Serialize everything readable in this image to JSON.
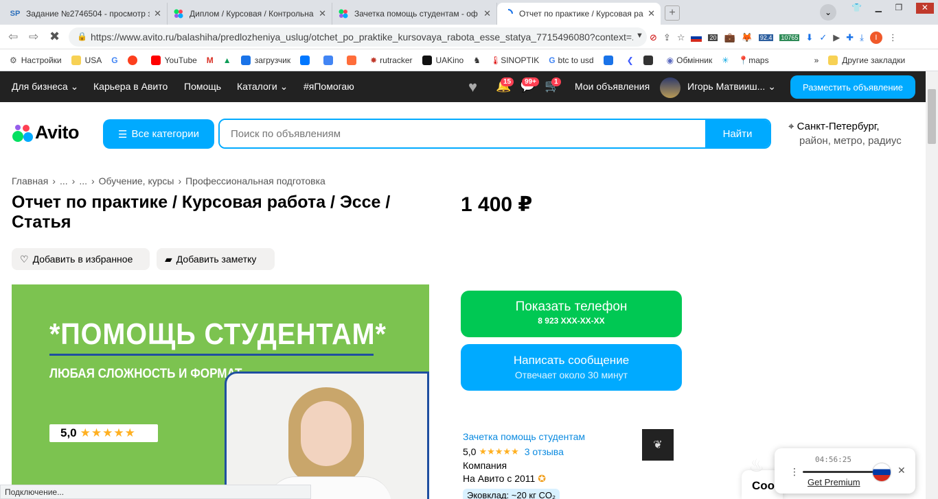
{
  "browser": {
    "tabs": [
      {
        "title": "Задание №2746504 - просмотр з",
        "favicon": "SP"
      },
      {
        "title": "Диплом / Курсовая / Контрольна",
        "favicon": "avito"
      },
      {
        "title": "Зачетка помощь студентам - оф",
        "favicon": "avito"
      },
      {
        "title": "Отчет по практике / Курсовая ра",
        "favicon": "loading"
      }
    ],
    "url": "https://www.avito.ru/balashiha/predlozheniya_uslug/otchet_po_praktike_kursovaya_rabota_esse_statya_7715496080?context=...",
    "ext_badges": [
      "20",
      "92.4",
      "10765"
    ],
    "profile_initial": "I",
    "bookmarks": [
      "Настройки",
      "USA",
      "",
      "",
      "YouTube",
      "",
      "",
      "загрузчик",
      "",
      "",
      "",
      "rutracker",
      "UAKino",
      "",
      "SINOPTIK",
      "btc to usd",
      "",
      "",
      "",
      "Обмінник",
      "",
      "maps"
    ],
    "bookmarks_more": "»",
    "bookmarks_other": "Другие закладки",
    "status_text": "Подключение..."
  },
  "header": {
    "nav": [
      "Для бизнеса",
      "Карьера в Авито",
      "Помощь",
      "Каталоги",
      "#яПомогаю"
    ],
    "badges": {
      "notifications": "15",
      "messages": "99+",
      "cart": "1"
    },
    "my_ads": "Мои объявления",
    "user_name": "Игорь Матвииш...",
    "post_button": "Разместить объявление"
  },
  "search": {
    "logo": "Avito",
    "categories_button": "Все категории",
    "placeholder": "Поиск по объявлениям",
    "find_button": "Найти",
    "location_city": "Санкт-Петербург,",
    "location_sub": "район, метро, радиус"
  },
  "listing": {
    "breadcrumbs": [
      "Главная",
      "...",
      "...",
      "Обучение, курсы",
      "Профессиональная подготовка"
    ],
    "title_line1": "Отчет по практике / Курсовая работа / Эссе /",
    "title_line2": "Статья",
    "price": "1 400 ₽",
    "favorite_button": "Добавить в избранное",
    "note_button": "Добавить заметку",
    "image": {
      "headline": "*ПОМОЩЬ СТУДЕНТАМ*",
      "subline": "ЛЮБАЯ СЛОЖНОСТЬ И ФОРМАТ",
      "rating": "5,0"
    },
    "show_phone": "Показать телефон",
    "phone_masked": "8 923 XXX-XX-XX",
    "write_message": "Написать сообщение",
    "response_time": "Отвечает около 30 минут"
  },
  "seller": {
    "name": "Зачетка помощь студентам",
    "rating": "5,0",
    "reviews": "3 отзыва",
    "type": "Компания",
    "since": "На Авито с 2011",
    "eco": "Эковклад: ~20 кг CO₂"
  },
  "player": {
    "time": "04:56:25",
    "premium": "Get Premium",
    "partial": "Coo"
  }
}
